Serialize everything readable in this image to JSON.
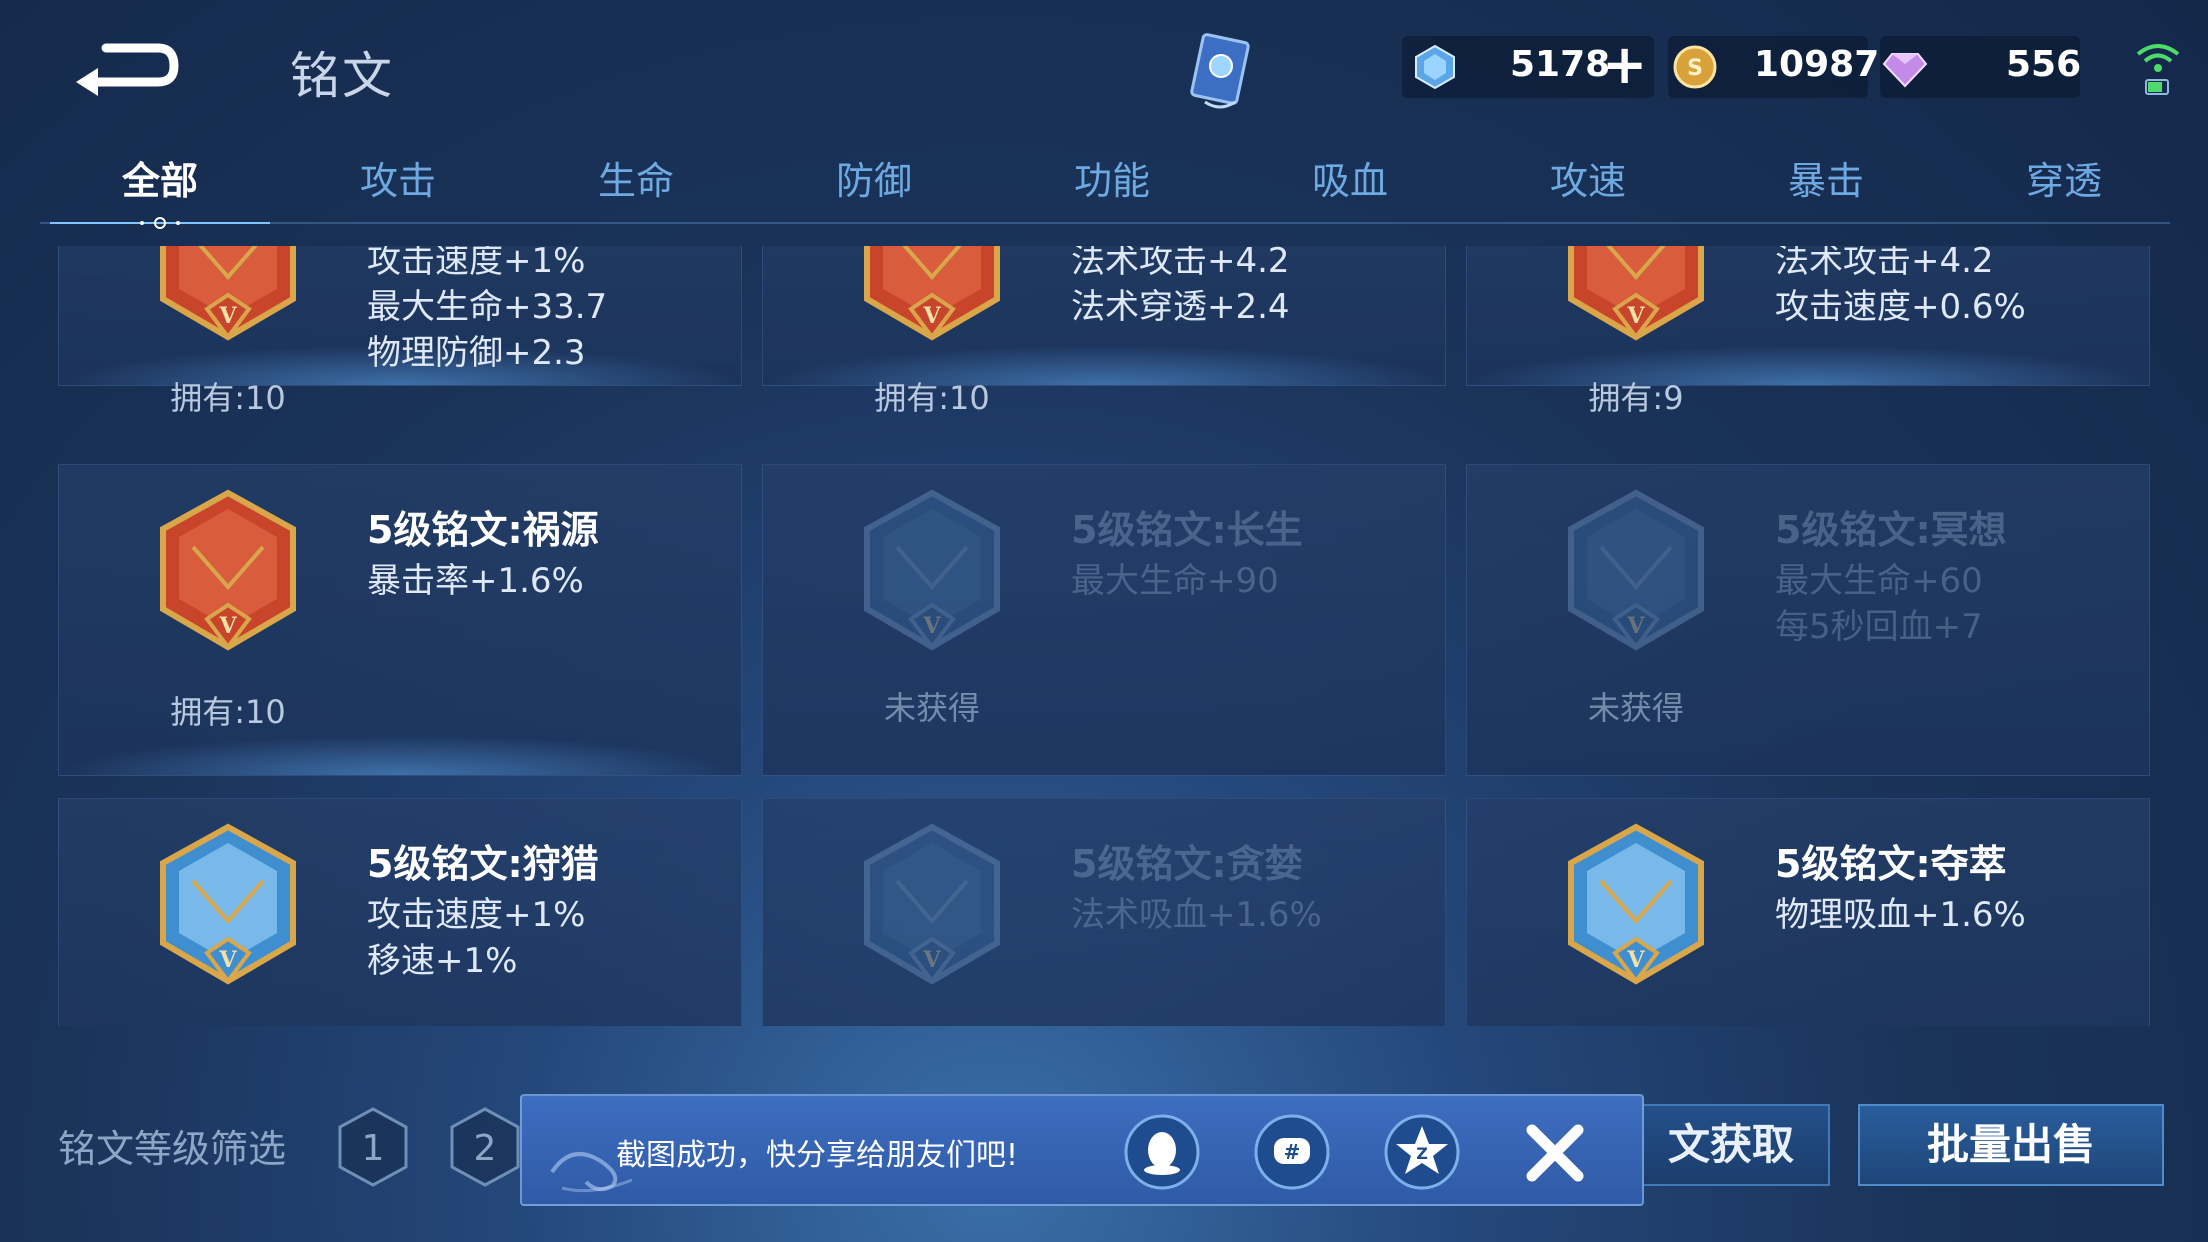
{
  "header": {
    "title": "铭文",
    "currencies": [
      {
        "icon": "crystal-icon",
        "value": "5178"
      },
      {
        "icon": "gold-coin-icon",
        "value": "10987"
      },
      {
        "icon": "diamond-icon",
        "value": "556"
      }
    ]
  },
  "tabs": [
    {
      "label": "全部",
      "active": true
    },
    {
      "label": "攻击",
      "active": false
    },
    {
      "label": "生命",
      "active": false
    },
    {
      "label": "防御",
      "active": false
    },
    {
      "label": "功能",
      "active": false
    },
    {
      "label": "吸血",
      "active": false
    },
    {
      "label": "攻速",
      "active": false
    },
    {
      "label": "暴击",
      "active": false
    },
    {
      "label": "穿透",
      "active": false
    }
  ],
  "cards": [
    {
      "name": "",
      "attrs": [
        "攻击速度+1%",
        "最大生命+33.7",
        "物理防御+2.3"
      ],
      "owned": "拥有:10",
      "locked": false,
      "color": "red"
    },
    {
      "name": "",
      "attrs": [
        "法术攻击+4.2",
        "法术穿透+2.4"
      ],
      "owned": "拥有:10",
      "locked": false,
      "color": "red"
    },
    {
      "name": "",
      "attrs": [
        "法术攻击+4.2",
        "攻击速度+0.6%"
      ],
      "owned": "拥有:9",
      "locked": false,
      "color": "red"
    },
    {
      "name": "5级铭文:祸源",
      "attrs": [
        "暴击率+1.6%"
      ],
      "owned": "拥有:10",
      "locked": false,
      "color": "red"
    },
    {
      "name": "5级铭文:长生",
      "attrs": [
        "最大生命+90"
      ],
      "owned": "未获得",
      "locked": true,
      "color": "blue"
    },
    {
      "name": "5级铭文:冥想",
      "attrs": [
        "最大生命+60",
        "每5秒回血+7"
      ],
      "owned": "未获得",
      "locked": true,
      "color": "blue"
    },
    {
      "name": "5级铭文:狩猎",
      "attrs": [
        "攻击速度+1%",
        "移速+1%"
      ],
      "owned": "",
      "locked": false,
      "color": "cyan"
    },
    {
      "name": "5级铭文:贪婪",
      "attrs": [
        "法术吸血+1.6%"
      ],
      "owned": "",
      "locked": true,
      "color": "blue"
    },
    {
      "name": "5级铭文:夺萃",
      "attrs": [
        "物理吸血+1.6%"
      ],
      "owned": "",
      "locked": false,
      "color": "cyan"
    }
  ],
  "footer": {
    "filter_label": "铭文等级筛选",
    "levels": [
      "1",
      "2"
    ],
    "get_button": "文获取",
    "sell_button": "批量出售"
  },
  "toast": {
    "message": "截图成功，快分享给朋友们吧!",
    "share_targets": [
      "qq-icon",
      "wechat-moments-icon",
      "qzone-icon"
    ]
  },
  "colors": {
    "accent": "#6fa9e2",
    "toast_bg": "#3a68b8",
    "gem_red": "#c8452c",
    "gem_gold": "#d9a64a"
  }
}
